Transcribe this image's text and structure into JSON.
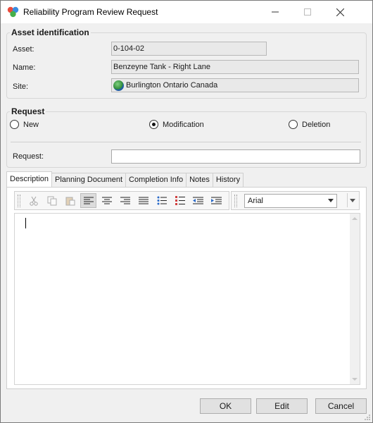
{
  "window": {
    "title": "Reliability Program Review Request"
  },
  "asset_identification": {
    "group_title": "Asset identification",
    "asset_label": "Asset:",
    "asset_value": "0-104-02",
    "name_label": "Name:",
    "name_value": "Benzeyne Tank - Right Lane",
    "site_label": "Site:",
    "site_value": "Burlington Ontario Canada"
  },
  "request": {
    "group_title": "Request",
    "options": [
      {
        "label": "New",
        "checked": false
      },
      {
        "label": "Modification",
        "checked": true
      },
      {
        "label": "Deletion",
        "checked": false
      }
    ],
    "request_label": "Request:",
    "request_value": ""
  },
  "tabs": [
    {
      "label": "Description",
      "active": true
    },
    {
      "label": "Planning Document",
      "active": false
    },
    {
      "label": "Completion Info",
      "active": false
    },
    {
      "label": "Notes",
      "active": false
    },
    {
      "label": "History",
      "active": false
    }
  ],
  "editor": {
    "font_value": "Arial",
    "text": ""
  },
  "buttons": {
    "ok": "OK",
    "edit": "Edit",
    "cancel": "Cancel"
  }
}
